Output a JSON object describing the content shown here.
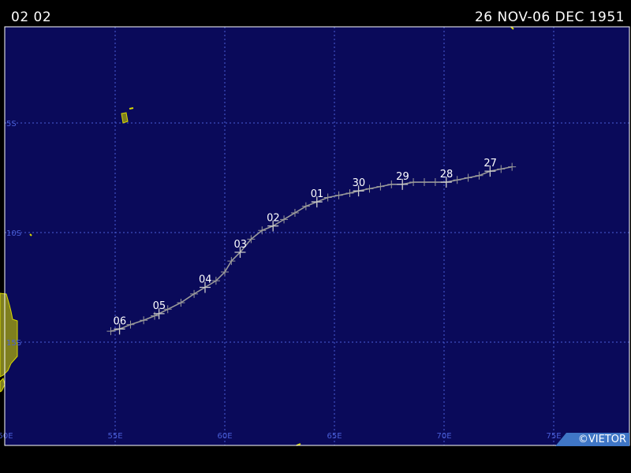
{
  "header": {
    "storm_id": "02 02",
    "date_range": "26 NOV-06 DEC 1951"
  },
  "credit": "©VIETOR",
  "colors": {
    "ocean": "#0a0a5a",
    "grid": "#4a5fd8",
    "land": "#7f7f1e",
    "coast": "#d9d900",
    "track": "#9a9a9a",
    "labels": "#ffffff"
  },
  "axes": {
    "lon_labels": [
      "50E",
      "55E",
      "60E",
      "65E",
      "70E",
      "75E"
    ],
    "lat_labels": [
      "5S",
      "10S",
      "15S"
    ]
  },
  "track": {
    "day_labels": [
      "27",
      "28",
      "29",
      "30",
      "01",
      "02",
      "03",
      "04",
      "05",
      "06"
    ],
    "points": [
      [
        73.1,
        -7.0
      ],
      [
        72.6,
        -7.1
      ],
      [
        72.1,
        -7.2
      ],
      [
        71.6,
        -7.4
      ],
      [
        71.1,
        -7.5
      ],
      [
        70.6,
        -7.6
      ],
      [
        70.1,
        -7.7
      ],
      [
        69.6,
        -7.7
      ],
      [
        69.1,
        -7.7
      ],
      [
        68.6,
        -7.7
      ],
      [
        68.1,
        -7.8
      ],
      [
        67.6,
        -7.8
      ],
      [
        67.1,
        -7.9
      ],
      [
        66.6,
        -8.0
      ],
      [
        66.1,
        -8.1
      ],
      [
        65.7,
        -8.2
      ],
      [
        65.2,
        -8.3
      ],
      [
        64.7,
        -8.4
      ],
      [
        64.2,
        -8.6
      ],
      [
        63.7,
        -8.8
      ],
      [
        63.2,
        -9.1
      ],
      [
        62.7,
        -9.4
      ],
      [
        62.2,
        -9.7
      ],
      [
        61.7,
        -9.9
      ],
      [
        61.2,
        -10.3
      ],
      [
        60.7,
        -10.9
      ],
      [
        60.3,
        -11.3
      ],
      [
        60.0,
        -11.8
      ],
      [
        59.6,
        -12.2
      ],
      [
        59.1,
        -12.5
      ],
      [
        58.6,
        -12.8
      ],
      [
        58.0,
        -13.2
      ],
      [
        57.4,
        -13.5
      ],
      [
        56.8,
        -13.8
      ],
      [
        56.3,
        -14.0
      ],
      [
        55.7,
        -14.2
      ],
      [
        55.2,
        -14.4
      ],
      [
        54.8,
        -14.5
      ]
    ],
    "labeled_points": [
      {
        "label": "27",
        "lon": 72.1,
        "lat": -7.2
      },
      {
        "label": "28",
        "lon": 70.1,
        "lat": -7.7
      },
      {
        "label": "29",
        "lon": 68.1,
        "lat": -7.8
      },
      {
        "label": "30",
        "lon": 66.1,
        "lat": -8.1
      },
      {
        "label": "01",
        "lon": 64.2,
        "lat": -8.6
      },
      {
        "label": "02",
        "lon": 62.2,
        "lat": -9.7
      },
      {
        "label": "03",
        "lon": 60.7,
        "lat": -10.9
      },
      {
        "label": "04",
        "lon": 59.1,
        "lat": -12.5
      },
      {
        "label": "05",
        "lon": 57.0,
        "lat": -13.7
      },
      {
        "label": "06",
        "lon": 55.2,
        "lat": -14.4
      }
    ]
  }
}
